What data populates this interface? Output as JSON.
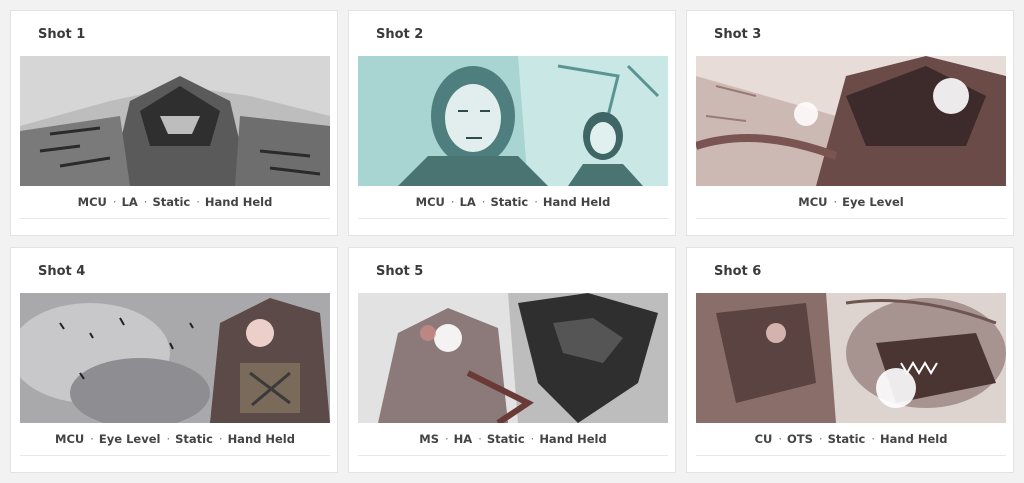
{
  "shots": [
    {
      "title": "Shot 1",
      "tags": [
        "MCU",
        "LA",
        "Static",
        "Hand Held"
      ],
      "palette": {
        "bg": "#bdbdbd",
        "mid": "#8a8a8a",
        "dark": "#3e3e3e",
        "accent": "#e8e8e8"
      }
    },
    {
      "title": "Shot 2",
      "tags": [
        "MCU",
        "LA",
        "Static",
        "Hand Held"
      ],
      "palette": {
        "bg": "#a8d4d2",
        "mid": "#6eb0ae",
        "dark": "#2f4c4c",
        "accent": "#e6f4f3"
      }
    },
    {
      "title": "Shot 3",
      "tags": [
        "MCU",
        "Eye Level"
      ],
      "palette": {
        "bg": "#d9c8c3",
        "mid": "#9a6f6a",
        "dark": "#3a2a2a",
        "accent": "#ffffff"
      }
    },
    {
      "title": "Shot 4",
      "tags": [
        "MCU",
        "Eye Level",
        "Static",
        "Hand Held"
      ],
      "palette": {
        "bg": "#a9a9ab",
        "mid": "#6d6d72",
        "dark": "#2e2e33",
        "accent": "#f1dcd8"
      }
    },
    {
      "title": "Shot 5",
      "tags": [
        "MS",
        "HA",
        "Static",
        "Hand Held"
      ],
      "palette": {
        "bg": "#e2e2e2",
        "mid": "#9c8c8c",
        "dark": "#2a2a2a",
        "accent": "#ffffff"
      }
    },
    {
      "title": "Shot 6",
      "tags": [
        "CU",
        "OTS",
        "Static",
        "Hand Held"
      ],
      "palette": {
        "bg": "#ddd3cf",
        "mid": "#a07f7a",
        "dark": "#3b2e2c",
        "accent": "#ffffff"
      }
    }
  ]
}
